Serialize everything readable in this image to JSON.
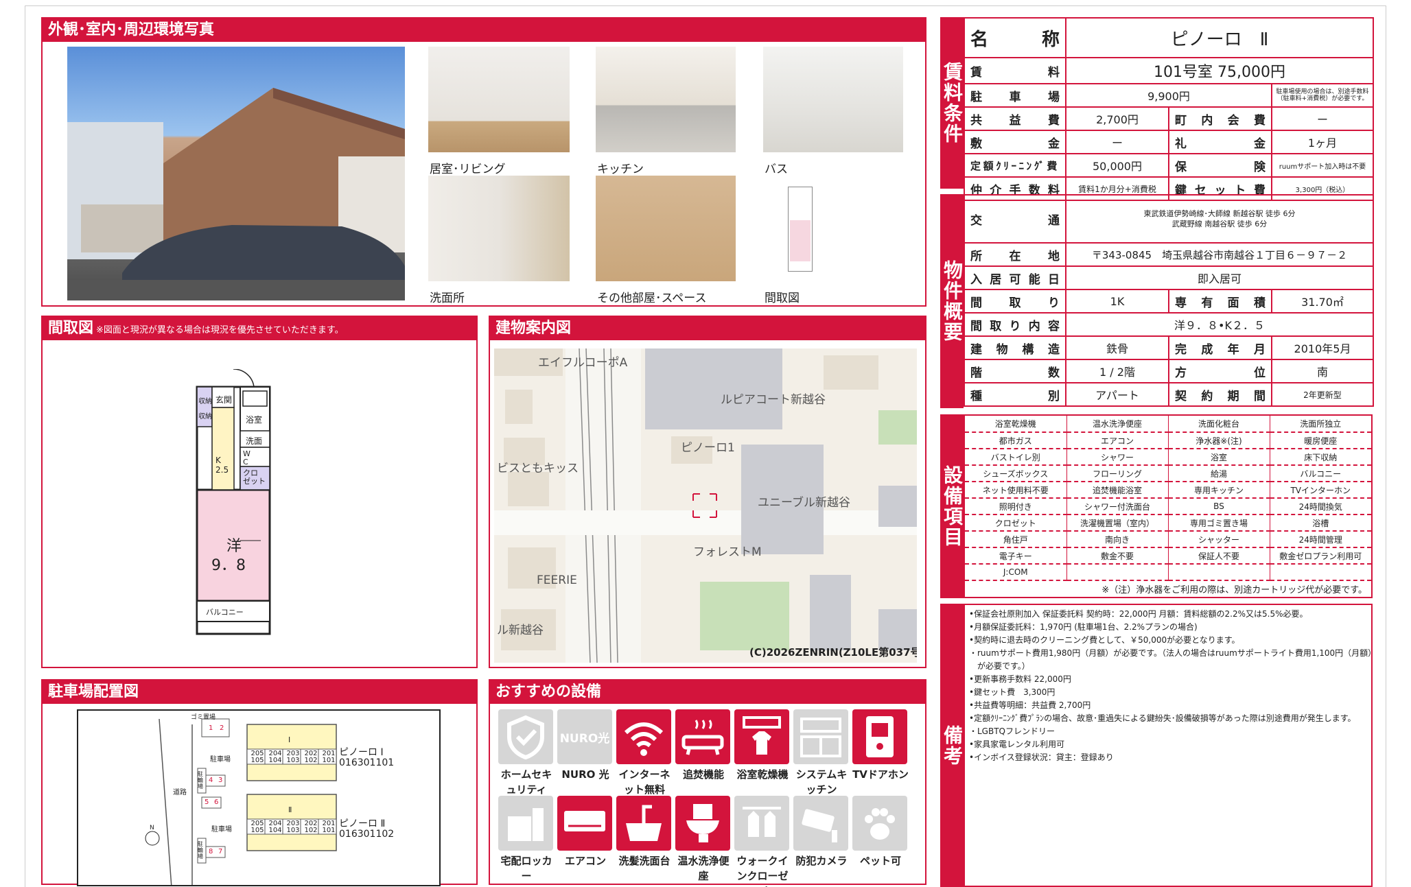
{
  "photos": {
    "title": "外観･室内･周辺環境写真",
    "captions": [
      "居室･リビング",
      "キッチン",
      "バス",
      "洗面所",
      "その他部屋･スペース",
      "間取図"
    ]
  },
  "floorplan": {
    "title": "間取図",
    "note": "※図面と現況が異なる場合は現況を優先させていただきます。",
    "labels": {
      "storage1": "収納",
      "storage2": "収納",
      "entrance": "玄関",
      "bath": "浴室",
      "wash": "洗面",
      "kitchen": "K\n2.5",
      "wc": "W\nC",
      "closet": "クロ\nゼット",
      "room": "洋",
      "room_size": "9．8",
      "balcony": "バルコニー"
    }
  },
  "map": {
    "title": "建物案内図",
    "labels": [
      "エイフルコーポA",
      "ルピアコート新越谷",
      "ビスともキッス",
      "ピノーロ1",
      "ユニーブル新越谷",
      "フォレストM",
      "FEERIE",
      "ル新越谷"
    ],
    "copyright": "(C)2026ZENRIN(Z10LE第037号)"
  },
  "parking": {
    "title": "駐車場配置図",
    "labels": {
      "garbage": "ゴミ置場",
      "parking1": "駐車場",
      "parking2": "駐車場",
      "bike1": "駐輪場",
      "bike2": "駐輪場",
      "road": "道路",
      "north": "N",
      "bldg1_name": "ピノーロ Ⅰ",
      "bldg1_code": "016301101",
      "bldg2_name": "ピノーロ Ⅱ",
      "bldg2_code": "016301102",
      "b1": "Ⅰ",
      "b2": "Ⅱ"
    },
    "spots": [
      "1",
      "2",
      "3",
      "4",
      "5",
      "6",
      "7",
      "8"
    ],
    "rooms_upper": [
      "205",
      "204",
      "203",
      "202",
      "201"
    ],
    "rooms_lower": [
      "105",
      "104",
      "103",
      "102",
      "101"
    ]
  },
  "recommended": {
    "title": "おすすめの設備",
    "items": [
      {
        "label": "ホームセキュリティ",
        "on": false,
        "icon": "shield-icon"
      },
      {
        "label": "NURO 光",
        "on": false,
        "icon": "nuro-icon",
        "tile_text": "NURO光"
      },
      {
        "label": "インターネット無料",
        "on": true,
        "icon": "wifi-icon"
      },
      {
        "label": "追焚機能",
        "on": true,
        "icon": "bathtub-icon"
      },
      {
        "label": "浴室乾燥機",
        "on": true,
        "icon": "bath-dryer-icon"
      },
      {
        "label": "システムキッチン",
        "on": false,
        "icon": "kitchen-icon"
      },
      {
        "label": "TVドアホン",
        "on": true,
        "icon": "intercom-icon"
      },
      {
        "label": "宅配ロッカー",
        "on": false,
        "icon": "locker-icon"
      },
      {
        "label": "エアコン",
        "on": true,
        "icon": "aircon-icon"
      },
      {
        "label": "洗髪洗面台",
        "on": true,
        "icon": "washbasin-icon"
      },
      {
        "label": "温水洗浄便座",
        "on": true,
        "icon": "toilet-icon"
      },
      {
        "label": "ウォークインクローゼット",
        "on": false,
        "icon": "closet-icon"
      },
      {
        "label": "防犯カメラ",
        "on": false,
        "icon": "camera-icon"
      },
      {
        "label": "ペット可",
        "on": false,
        "icon": "paw-icon"
      }
    ]
  },
  "rent": {
    "tab": "賃料条件",
    "name_label": "名　称",
    "name": "ピノーロ　Ⅱ",
    "rent_label": "賃料",
    "rent": "101号室 75,000円",
    "parking_label": "駐車場",
    "parking": "9,900円",
    "parking_note": "駐車場使用の場合は、別途手数料（駐車料+消費税）が必要です。",
    "common_label": "共益費",
    "common": "2,700円",
    "town_label": "町内会費",
    "town": "ー",
    "deposit_label": "敷金",
    "deposit": "ー",
    "key_money_label": "礼金",
    "key_money": "1ヶ月",
    "cleaning_label": "定額ｸﾘｰﾆﾝｸﾞ費",
    "cleaning": "50,000円",
    "insurance_label": "保険",
    "insurance": "ruumサポート加入時は不要",
    "brokerage_label": "仲介手数料",
    "brokerage": "賃料1か月分+消費税",
    "keyset_label": "鍵セット費",
    "keyset": "3,300円（税込）"
  },
  "overview": {
    "tab": "物件概要",
    "transport_label": "交通",
    "transport1": "東武鉄道伊勢崎線･大師線 新越谷駅 徒歩 6分",
    "transport2": "武蔵野線 南越谷駅 徒歩 6分",
    "address_label": "所在地",
    "address": "〒343-0845　埼玉県越谷市南越谷１丁目６－９７－２",
    "move_in_label": "入居可能日",
    "move_in": "即入居可",
    "layout_label": "間取り",
    "layout": "1K",
    "area_label": "専有面積",
    "area": "31.70㎡",
    "layout_detail_label": "間取り内容",
    "layout_detail": "洋９．８•K２．５",
    "structure_label": "建物構造",
    "structure": "鉄骨",
    "built_label": "完成年月",
    "built": "2010年5月",
    "floor_label": "階数",
    "floor": "1 / 2階",
    "direction_label": "方位",
    "direction": "南",
    "type_label": "種別",
    "type": "アパート",
    "contract_label": "契約期間",
    "contract": "2年更新型"
  },
  "equipment": {
    "tab": "設備項目",
    "rows": [
      [
        "浴室乾燥機",
        "温水洗浄便座",
        "洗面化粧台",
        "洗面所独立"
      ],
      [
        "都市ガス",
        "エアコン",
        "浄水器※(注)",
        "暖房便座"
      ],
      [
        "バストイレ別",
        "シャワー",
        "浴室",
        "床下収納"
      ],
      [
        "シューズボックス",
        "フローリング",
        "給湯",
        "バルコニー"
      ],
      [
        "ネット使用料不要",
        "追焚機能浴室",
        "専用キッチン",
        "TVインターホン"
      ],
      [
        "照明付き",
        "シャワー付洗面台",
        "BS",
        "24時間換気"
      ],
      [
        "クロゼット",
        "洗濯機置場（室内）",
        "専用ゴミ置き場",
        "浴槽"
      ],
      [
        "角住戸",
        "南向き",
        "シャッター",
        "24時間管理"
      ],
      [
        "電子キー",
        "敷金不要",
        "保証人不要",
        "敷金ゼロプラン利用可"
      ],
      [
        "J:COM",
        "",
        "",
        ""
      ]
    ],
    "note": "※（注）浄水器をご利用の際は、別途カートリッジ代が必要です。"
  },
  "remarks": {
    "tab": "備考",
    "lines": [
      "•保証会社原則加入 保証委託料 契約時：22,000円 月額：賃料総額の2.2%又は5.5%必要。",
      "•月額保証委託料：1,970円 (駐車場1台、2.2%プランの場合)",
      "•契約時に退去時のクリーニング費として、￥50,000が必要となります。",
      "・ruumサポート費用1,980円（月額）が必要です。（法人の場合はruumサポートライト費用1,100円（月額）",
      "　が必要です。）",
      "•更新事務手数料 22,000円",
      "•鍵セット費　3,300円",
      "•共益費等明細：共益費 2,700円",
      "•定額ｸﾘｰﾆﾝｸﾞ費ﾌﾟﾗﾝの場合、故意･重過失による鍵紛失･設備破損等があった際は別途費用が発生します。",
      "・LGBTQフレンドリー",
      "•家具家電レンタル利用可",
      "•インボイス登録状況：貸主：登録あり"
    ]
  }
}
